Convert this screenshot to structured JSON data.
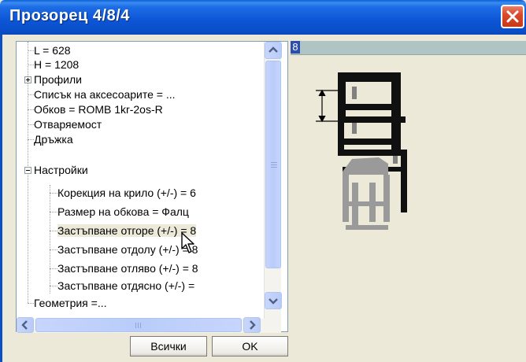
{
  "window": {
    "title": "Прозорец  4/8/4"
  },
  "tree": {
    "items": [
      {
        "label": "L = 628",
        "level": 0
      },
      {
        "label": "H = 1208",
        "level": 0
      },
      {
        "label": "Профили",
        "level": 0,
        "expander": "plus"
      },
      {
        "label": "Списък на аксесоарите = ...",
        "level": 0
      },
      {
        "label": "Обков =  ROMB 1kr-2os-R",
        "level": 0
      },
      {
        "label": "Отваряемост",
        "level": 0
      },
      {
        "label": "Дръжка",
        "level": 0
      },
      {
        "label": "Настройки",
        "level": 0,
        "expander": "minus"
      },
      {
        "label": "Корекция на крило (+/-)   = 6",
        "level": 1
      },
      {
        "label": "Размер на обкова    = Фалц",
        "level": 1
      },
      {
        "label": "Застъпване отгоре (+/-)  = 8",
        "level": 1,
        "selected": true
      },
      {
        "label": "Застъпване отдолу (+/-)  = 8",
        "level": 1
      },
      {
        "label": "Застъпване отляво (+/-)  = 8",
        "level": 1
      },
      {
        "label": "Застъпване отдясно (+/-)   =",
        "level": 1
      },
      {
        "label": "Геометрия  =...",
        "level": 0
      }
    ]
  },
  "buttons": {
    "all_label": "Всички",
    "ok_label": "OK"
  },
  "preview": {
    "value_label": "8"
  },
  "colors": {
    "titlebar": "#0c55d6",
    "close": "#d9492c",
    "selection": "#ece9d8",
    "profile_dark": "#101010",
    "profile_gray": "#9a9a9a"
  },
  "icons": {
    "close": "close-icon",
    "scroll_up": "arrow-up-icon",
    "scroll_down": "arrow-down-icon",
    "scroll_left": "arrow-left-icon",
    "scroll_right": "arrow-right-icon",
    "cursor": "mouse-pointer-icon"
  }
}
